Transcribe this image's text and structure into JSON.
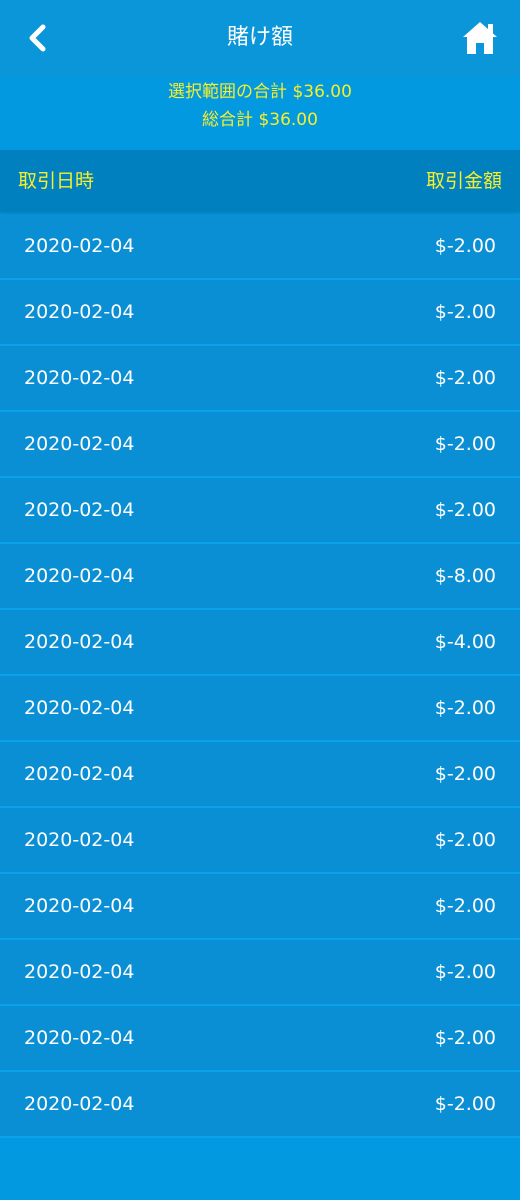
{
  "header": {
    "title": "賭け額",
    "back_icon": "chevron-left-icon",
    "home_icon": "home-icon"
  },
  "summary": {
    "selected_total": "選択範囲の合計 $36.00",
    "grand_total": "総合計 $36.00"
  },
  "table": {
    "columns": {
      "date": "取引日時",
      "amount": "取引金額"
    },
    "rows": [
      {
        "date": "2020-02-04",
        "amount": "$-2.00"
      },
      {
        "date": "2020-02-04",
        "amount": "$-2.00"
      },
      {
        "date": "2020-02-04",
        "amount": "$-2.00"
      },
      {
        "date": "2020-02-04",
        "amount": "$-2.00"
      },
      {
        "date": "2020-02-04",
        "amount": "$-2.00"
      },
      {
        "date": "2020-02-04",
        "amount": "$-8.00"
      },
      {
        "date": "2020-02-04",
        "amount": "$-4.00"
      },
      {
        "date": "2020-02-04",
        "amount": "$-2.00"
      },
      {
        "date": "2020-02-04",
        "amount": "$-2.00"
      },
      {
        "date": "2020-02-04",
        "amount": "$-2.00"
      },
      {
        "date": "2020-02-04",
        "amount": "$-2.00"
      },
      {
        "date": "2020-02-04",
        "amount": "$-2.00"
      },
      {
        "date": "2020-02-04",
        "amount": "$-2.00"
      },
      {
        "date": "2020-02-04",
        "amount": "$-2.00"
      }
    ]
  },
  "colors": {
    "background": "#0399e0",
    "header_bar": "#0a96d9",
    "column_header": "#0180bf",
    "row": "#0a8fd4",
    "highlight_text": "#f7ef2a",
    "text": "#ffffff"
  }
}
